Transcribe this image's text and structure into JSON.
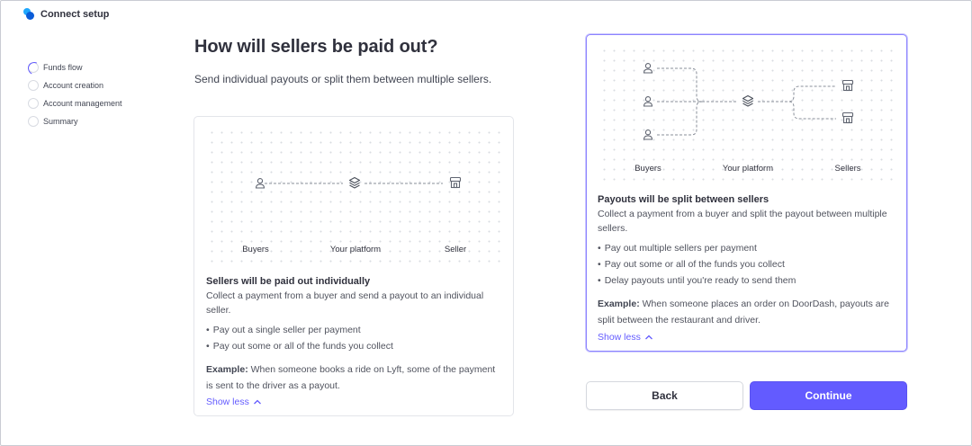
{
  "app": {
    "title": "Connect setup"
  },
  "steps": [
    {
      "label": "Funds flow",
      "active": true
    },
    {
      "label": "Account creation",
      "active": false
    },
    {
      "label": "Account management",
      "active": false
    },
    {
      "label": "Summary",
      "active": false
    }
  ],
  "page": {
    "title": "How will sellers be paid out?",
    "subtitle": "Send individual payouts or split them between multiple sellers."
  },
  "option_individual": {
    "labels": {
      "buyers": "Buyers",
      "platform": "Your platform",
      "seller": "Seller"
    },
    "title": "Sellers will be paid out individually",
    "description": "Collect a payment from a buyer and send a payout to an individual seller.",
    "bullets": [
      "Pay out a single seller per payment",
      "Pay out some or all of the funds you collect"
    ],
    "example_label": "Example:",
    "example_text": "When someone books a ride on Lyft, some of the payment is sent to the driver as a payout.",
    "show_less": "Show less"
  },
  "option_split": {
    "labels": {
      "buyers": "Buyers",
      "platform": "Your platform",
      "sellers": "Sellers"
    },
    "title": "Payouts will be split between sellers",
    "description": "Collect a payment from a buyer and split the payout between multiple sellers.",
    "bullets": [
      "Pay out multiple sellers per payment",
      "Pay out some or all of the funds you collect",
      "Delay payouts until you're ready to send them"
    ],
    "example_label": "Example:",
    "example_text": "When someone places an order on DoorDash, payouts are split between the restaurant and driver.",
    "show_less": "Show less"
  },
  "buttons": {
    "back": "Back",
    "continue": "Continue"
  },
  "colors": {
    "accent": "#635bff",
    "selected_border": "#8b83ff"
  },
  "icons": {
    "buyer": "user-icon",
    "platform": "layers-icon",
    "seller": "store-icon",
    "chevron": "chevron-up-icon"
  }
}
